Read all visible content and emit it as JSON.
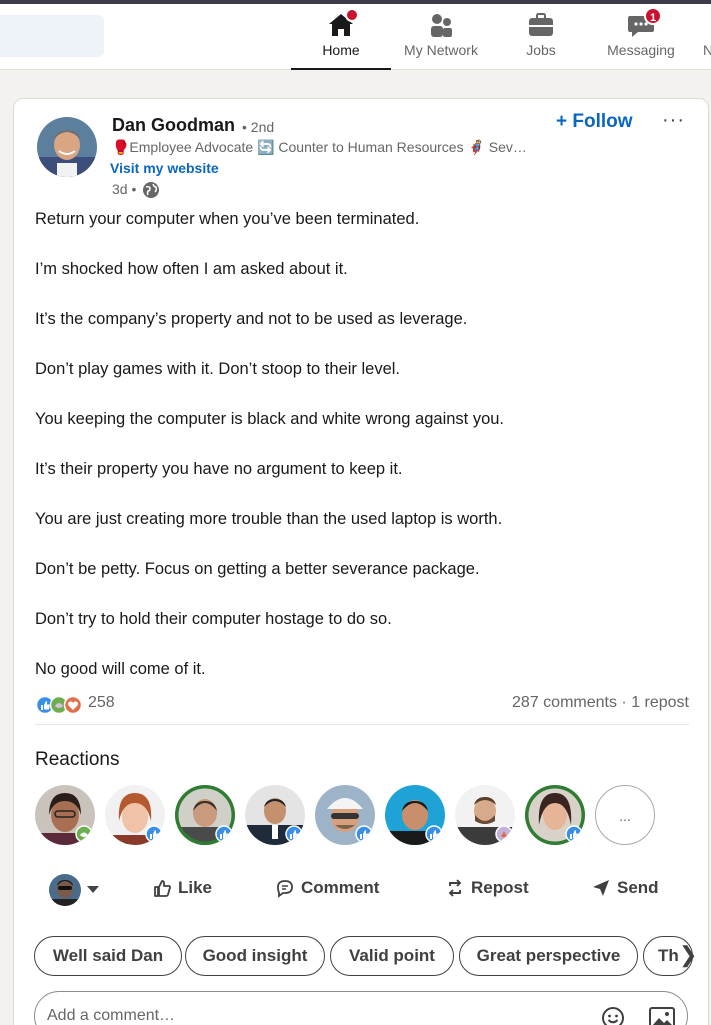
{
  "nav": {
    "items": [
      {
        "label": "Home",
        "icon": "home-icon",
        "badge": ""
      },
      {
        "label": "My Network",
        "icon": "network-icon",
        "badge": ""
      },
      {
        "label": "Jobs",
        "icon": "briefcase-icon",
        "badge": ""
      },
      {
        "label": "Messaging",
        "icon": "messaging-icon",
        "badge": "1"
      },
      {
        "label": "N",
        "icon": "",
        "badge": ""
      }
    ]
  },
  "post": {
    "author": "Dan Goodman",
    "degree": "• 2nd",
    "headline": "🥊Employee Advocate 🔄 Counter to Human Resources 🦸 Sev…",
    "link_label": "Visit my website",
    "time": "3d •",
    "follow_label": "+ Follow",
    "more_label": "···",
    "body": [
      "Return your computer when you’ve been terminated.",
      "I’m shocked how often I am asked about it.",
      "It’s the company’s property and not to be used as leverage.",
      "Don’t play games with it. Don’t stoop to their level.",
      "You keeping the computer is black and white wrong against you.",
      "It’s their property you have no argument to keep it.",
      "You are just creating more trouble than the used laptop is worth.",
      "Don’t be petty. Focus on getting a better severance package.",
      "Don’t try to hold their computer hostage to do so.",
      "No good will come of it."
    ],
    "reaction_count": "258",
    "comments_reposts": "287 comments · 1 repost"
  },
  "reactions": {
    "title": "Reactions",
    "more_label": "..."
  },
  "actions": {
    "like": "Like",
    "comment": "Comment",
    "repost": "Repost",
    "send": "Send"
  },
  "suggestions": [
    "Well said Dan",
    "Good insight",
    "Valid point",
    "Great perspective",
    "Th"
  ],
  "comment": {
    "placeholder": "Add a comment…"
  },
  "colors": {
    "accent": "#0a66c2",
    "badge": "#cb112d"
  }
}
